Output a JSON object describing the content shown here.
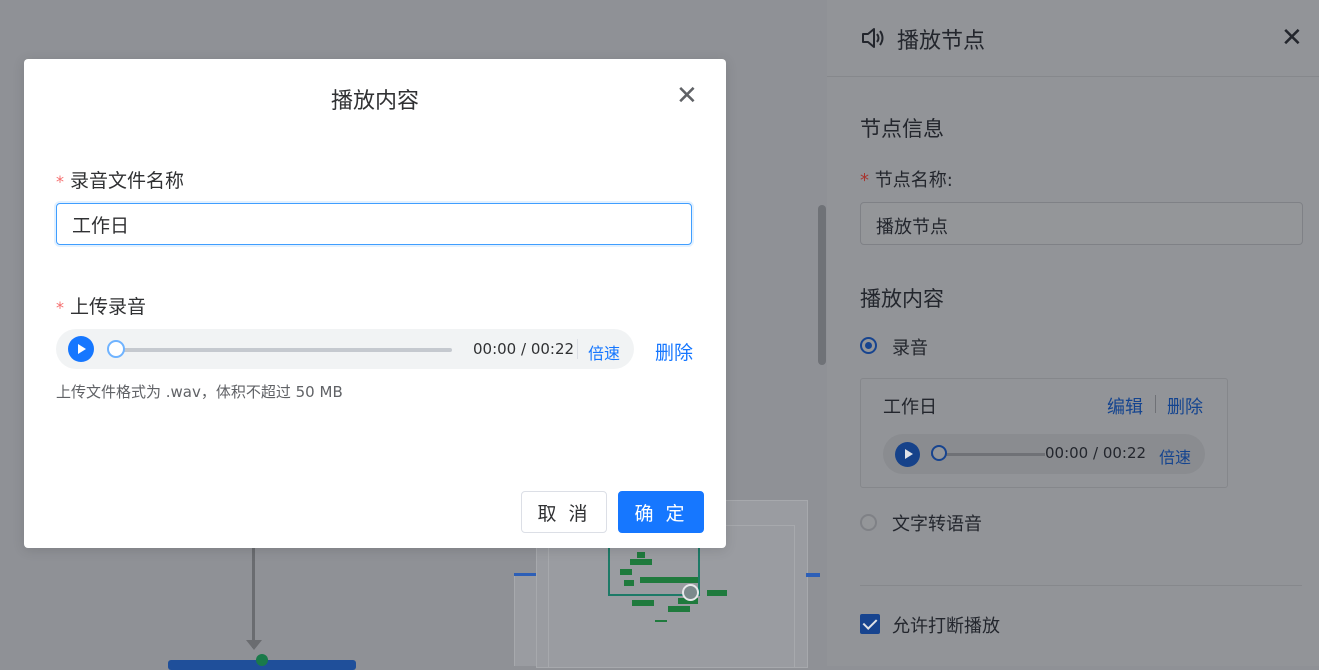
{
  "modal": {
    "title": "播放内容",
    "close_glyph": "✕",
    "filename_label": "录音文件名称",
    "filename_value": "工作日",
    "upload_label": "上传录音",
    "required_mark": "*",
    "player": {
      "time": "00:00 / 00:22",
      "speed_label": "倍速",
      "progress": 0
    },
    "delete_label": "删除",
    "hint": "上传文件格式为 .wav，体积不超过 50 MB",
    "cancel_label": "取 消",
    "confirm_label": "确 定"
  },
  "drawer": {
    "title": "播放节点",
    "title_icon": "speaker-icon",
    "close_glyph": "✕",
    "section_info": "节点信息",
    "name_label": "节点名称:",
    "name_value": "播放节点",
    "section_content": "播放内容",
    "radio_recording": "录音",
    "radio_tts": "文字转语音",
    "card": {
      "filename": "工作日",
      "edit_label": "编辑",
      "delete_label": "删除",
      "time": "00:00 / 00:22",
      "speed_label": "倍速"
    },
    "allow_interrupt_label": "允许打断播放",
    "allow_interrupt_checked": true
  },
  "colors": {
    "primary": "#1677ff",
    "required": "#f56c6c",
    "overlay": "#8f9196"
  }
}
